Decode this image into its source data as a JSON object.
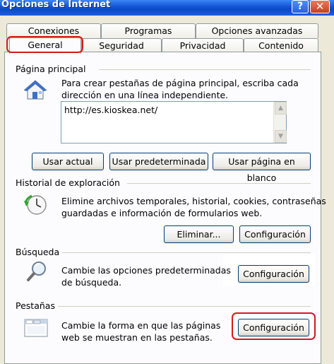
{
  "window": {
    "title": "Opciones de Internet",
    "help_glyph": "?",
    "close_glyph": "✕"
  },
  "tabs": {
    "row1": [
      "Conexiones",
      "Programas",
      "Opciones avanzadas"
    ],
    "row2": [
      "General",
      "Seguridad",
      "Privacidad",
      "Contenido"
    ],
    "active": "General"
  },
  "home": {
    "label": "Página principal",
    "desc_line1": "Para crear pestañas de página principal, escriba cada",
    "desc_line2": "dirección en una línea independiente.",
    "url": "http://es.kioskea.net/",
    "btn_current": "Usar actual",
    "btn_default": "Usar predeterminada",
    "btn_blank": "Usar página en blanco",
    "icon": "house-icon"
  },
  "history": {
    "label": "Historial de exploración",
    "desc_line1": "Elimine archivos temporales, historial, cookies, contraseñas",
    "desc_line2": "guardadas e información de formularios web.",
    "btn_delete": "Eliminar...",
    "btn_config": "Configuración",
    "icon": "history-clock-icon"
  },
  "search": {
    "label": "Búsqueda",
    "desc_line1": "Cambie las opciones predeterminadas",
    "desc_line2": "de búsqueda.",
    "btn_config": "Configuración",
    "icon": "magnifier-icon"
  },
  "tabs_section": {
    "label": "Pestañas",
    "desc_line1": "Cambie la forma en que las páginas",
    "desc_line2": "web se muestran en las pestañas.",
    "btn_config": "Configuración",
    "icon": "tabbed-window-icon"
  },
  "colors": {
    "titlebar": "#1657d8",
    "highlight": "#d61a1a",
    "panel": "#fcfcfe"
  }
}
